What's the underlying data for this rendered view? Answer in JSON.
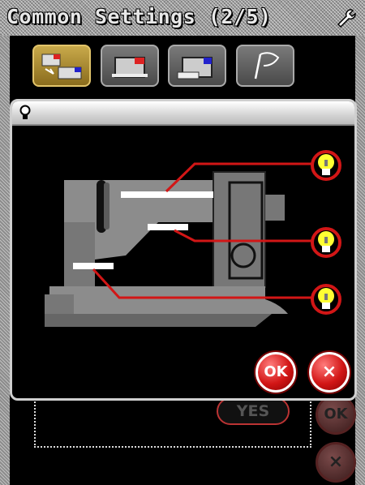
{
  "header": {
    "title": "Common Settings (2/5)",
    "icon": "wrench-icon"
  },
  "tabs": [
    {
      "icon": "machine-settings-icon",
      "active": true
    },
    {
      "icon": "sewing-settings-icon",
      "active": false
    },
    {
      "icon": "embroidery-settings-icon",
      "active": false
    },
    {
      "icon": "language-flag-icon",
      "active": false
    }
  ],
  "background_dialog": {
    "yes_label": "YES",
    "ok_label": "OK",
    "close_label": "×"
  },
  "popup": {
    "header_icon": "lightbulb-icon",
    "lights": [
      {
        "name": "upper-light",
        "icon": "lightbulb-icon"
      },
      {
        "name": "needle-light",
        "icon": "lightbulb-icon"
      },
      {
        "name": "base-light",
        "icon": "lightbulb-icon"
      }
    ],
    "ok_label": "OK",
    "close_label": "×"
  },
  "colors": {
    "accent_red": "#d21616",
    "bulb_yellow": "#ffff33",
    "tab_active": "#c8a94a"
  }
}
